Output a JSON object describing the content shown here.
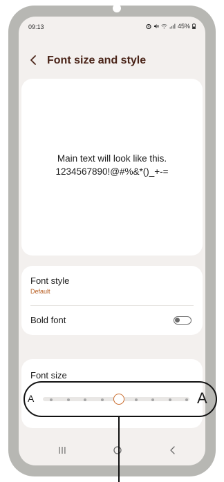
{
  "status_bar": {
    "time": "09:13",
    "icons": [
      "alarm-icon",
      "mute-icon",
      "wifi-icon",
      "signal-icon"
    ],
    "battery": "45%"
  },
  "header": {
    "title": "Font size and style"
  },
  "preview": {
    "line1": "Main text will look like this.",
    "line2": "1234567890!@#%&*()_+-="
  },
  "settings": {
    "font_style_label": "Font style",
    "font_style_value": "Default",
    "bold_font_label": "Bold font",
    "bold_font_enabled": false
  },
  "font_size": {
    "label": "Font size",
    "small_label": "A",
    "large_label": "A",
    "steps": 9,
    "selected_step": 4
  },
  "colors": {
    "accent": "#c96a2a",
    "title": "#4a2418",
    "screen_background": "#f3f0ee",
    "frame": "#b7b7b3"
  }
}
